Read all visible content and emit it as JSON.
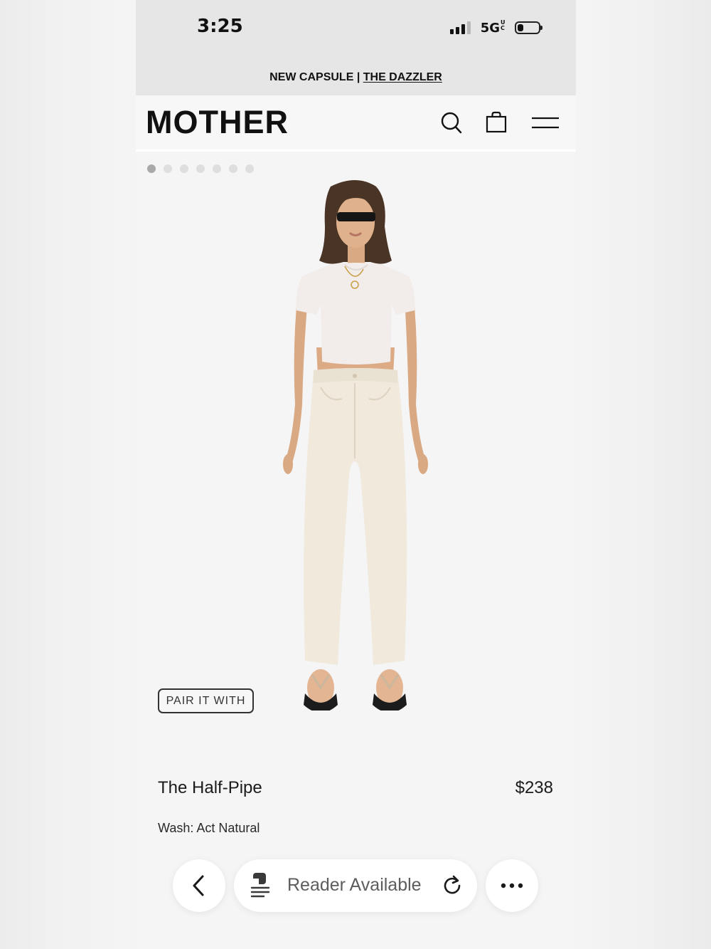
{
  "status_bar": {
    "time": "3:25",
    "network": "5G",
    "network_superscript": "UC",
    "signal_bars": 3,
    "signal_bars_total": 4,
    "battery_percent": 30
  },
  "promo": {
    "text": "NEW CAPSULE | ",
    "link": "THE DAZZLER"
  },
  "header": {
    "logo": "MOTHER",
    "icons": [
      "search-icon",
      "shopping-bag-icon",
      "menu-icon"
    ]
  },
  "carousel": {
    "total": 7,
    "active": 1
  },
  "product": {
    "pair_label": "PAIR IT WITH",
    "name": "The Half-Pipe",
    "price": "$238",
    "wash": "Wash: Act Natural"
  },
  "browser_toolbar": {
    "reader_label": "Reader Available",
    "icons": [
      "back-chevron-icon",
      "reader-icon",
      "reload-icon",
      "more-icon"
    ]
  },
  "colors": {
    "page_bg": "#f5f5f5",
    "chrome_bg": "#e6e6e6",
    "text": "#111111",
    "pants": "#f0e9dc",
    "top": "#f4efeb"
  }
}
